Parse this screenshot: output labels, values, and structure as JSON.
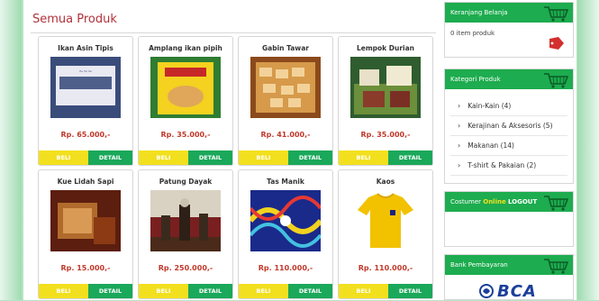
{
  "main": {
    "title": "Semua Produk",
    "buy_label": "BELI",
    "detail_label": "DETAIL",
    "products": [
      {
        "name": "Ikan Asin Tipis",
        "price": "Rp. 65.000,-"
      },
      {
        "name": "Amplang ikan pipih",
        "price": "Rp. 35.000,-"
      },
      {
        "name": "Gabin Tawar",
        "price": "Rp. 41.000,-"
      },
      {
        "name": "Lempok Durian",
        "price": "Rp. 35.000,-"
      },
      {
        "name": "Kue Lidah Sapi",
        "price": "Rp. 15.000,-"
      },
      {
        "name": "Patung Dayak",
        "price": "Rp. 250.000,-"
      },
      {
        "name": "Tas Manik",
        "price": "Rp. 110.000,-"
      },
      {
        "name": "Kaos",
        "price": "Rp. 110.000,-"
      }
    ]
  },
  "sidebar": {
    "cart": {
      "title": "Keranjang Belanja",
      "empty_text": "0 item produk"
    },
    "categories": {
      "title": "Kategori Produk",
      "items": [
        {
          "label": "Kain-Kain (4)"
        },
        {
          "label": "Kerajinan & Aksesoris (5)"
        },
        {
          "label": "Makanan (14)"
        },
        {
          "label": "T-shirt & Pakaian (2)"
        }
      ]
    },
    "customer": {
      "title": "Costumer",
      "online": "Online",
      "logout": "LOGOUT"
    },
    "bank": {
      "title": "Bank Pembayaran",
      "logo_text": "BCA"
    }
  },
  "colors": {
    "accent_green": "#1dac4f",
    "price_red": "#c0392b",
    "beli_yellow": "#f2e01e"
  }
}
